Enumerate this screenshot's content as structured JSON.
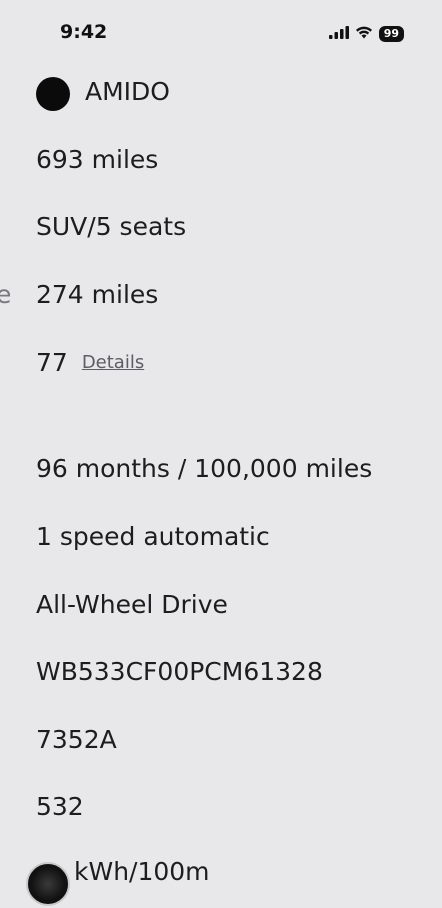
{
  "status_bar": {
    "time": "9:42",
    "battery": "99",
    "icons": [
      "signal-icon",
      "wifi-icon",
      "battery-icon"
    ]
  },
  "vehicle": {
    "make": "AMIDO",
    "range": "693 miles",
    "body": "SUV/5 seats",
    "partial_label": "e",
    "miles": "274 miles",
    "score": "77",
    "details_link": "Details",
    "warranty": "96 months / 100,000 miles",
    "transmission": "1 speed automatic",
    "drivetrain": "All-Wheel Drive",
    "vin": "WB533CF00PCM61328",
    "stock": "7352A",
    "code": "532",
    "efficiency_partial": "kWh/100m"
  },
  "colors": {
    "background": "#e8e7ea",
    "text": "#1d1d1f",
    "link": "#5e5e62"
  }
}
